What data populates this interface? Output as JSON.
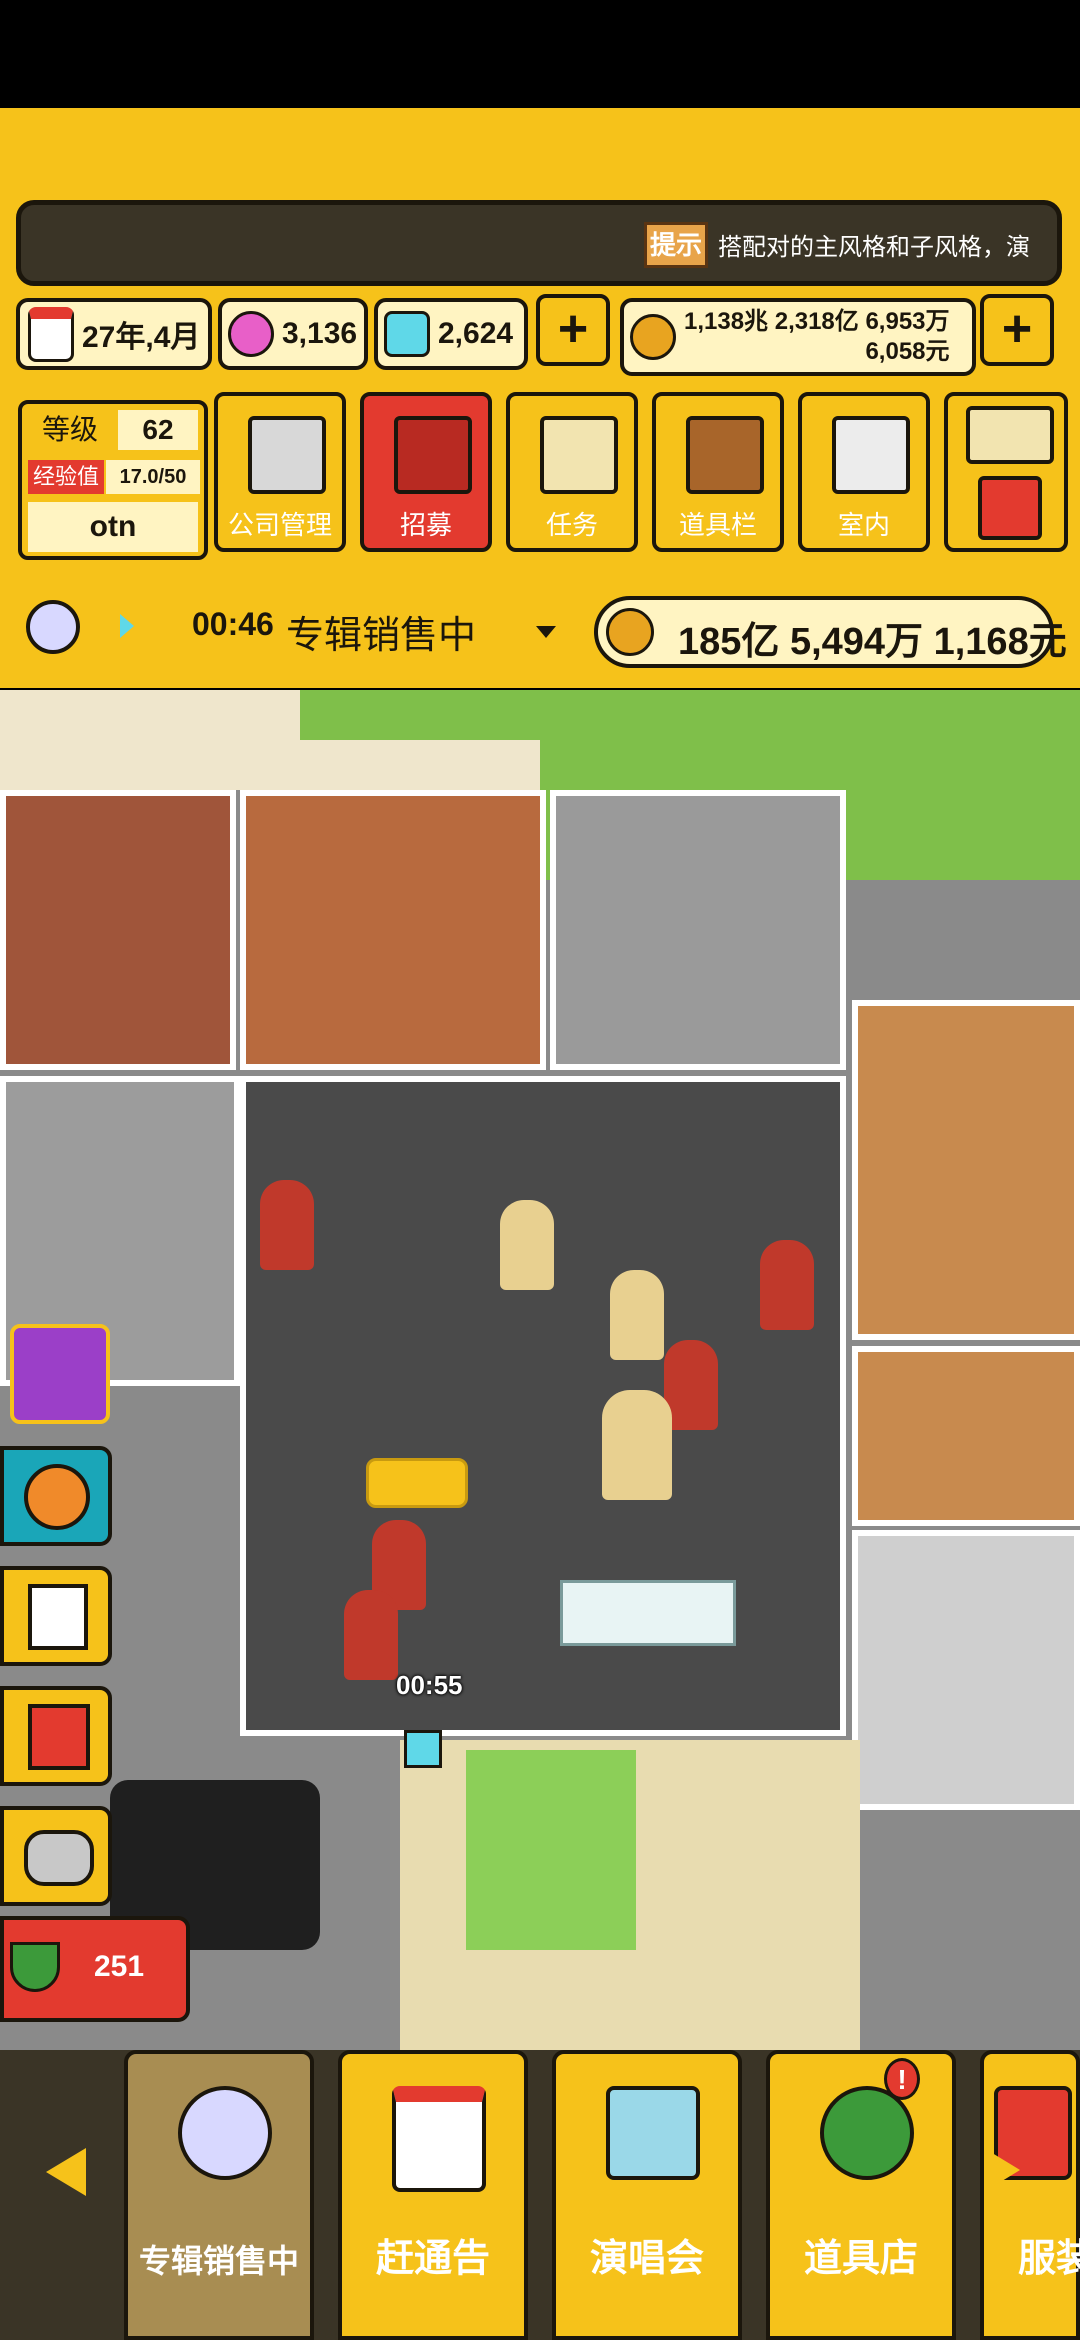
{
  "tip": {
    "badge": "提示",
    "text": "搭配对的主风格和子风格，演"
  },
  "stats": {
    "date": "27年,4月",
    "gems_pink": "3,136",
    "gems_blue": "2,624",
    "money_line1": "1,138兆 2,318亿 6,953万",
    "money_line2": "6,058元"
  },
  "level": {
    "label": "等级",
    "value": "62",
    "exp_label": "经验值",
    "exp_value": "17.0/50",
    "name": "otn"
  },
  "menu": [
    {
      "label": "公司管理",
      "icon": "building-icon"
    },
    {
      "label": "招募",
      "icon": "megaphone-icon"
    },
    {
      "label": "任务",
      "icon": "scroll-icon"
    },
    {
      "label": "道具栏",
      "icon": "chest-icon"
    },
    {
      "label": "室内",
      "icon": "paint-roller-icon"
    }
  ],
  "status": {
    "timer": "00:46",
    "text": "专辑销售中",
    "income": "185亿 5,494万 1,168元"
  },
  "scene": {
    "timer": "00:55",
    "side_count": "251"
  },
  "bottom_tabs": [
    {
      "label": "专辑销售中",
      "icon": "cd-icon"
    },
    {
      "label": "赶通告",
      "icon": "calendar-icon"
    },
    {
      "label": "演唱会",
      "icon": "rainbow-stage-icon"
    },
    {
      "label": "道具店",
      "icon": "clover-icon"
    },
    {
      "label": "服装",
      "icon": "clothes-icon"
    }
  ],
  "colors": {
    "yellow": "#f6c21a",
    "dark": "#1b160c",
    "red": "#e33a2f"
  }
}
